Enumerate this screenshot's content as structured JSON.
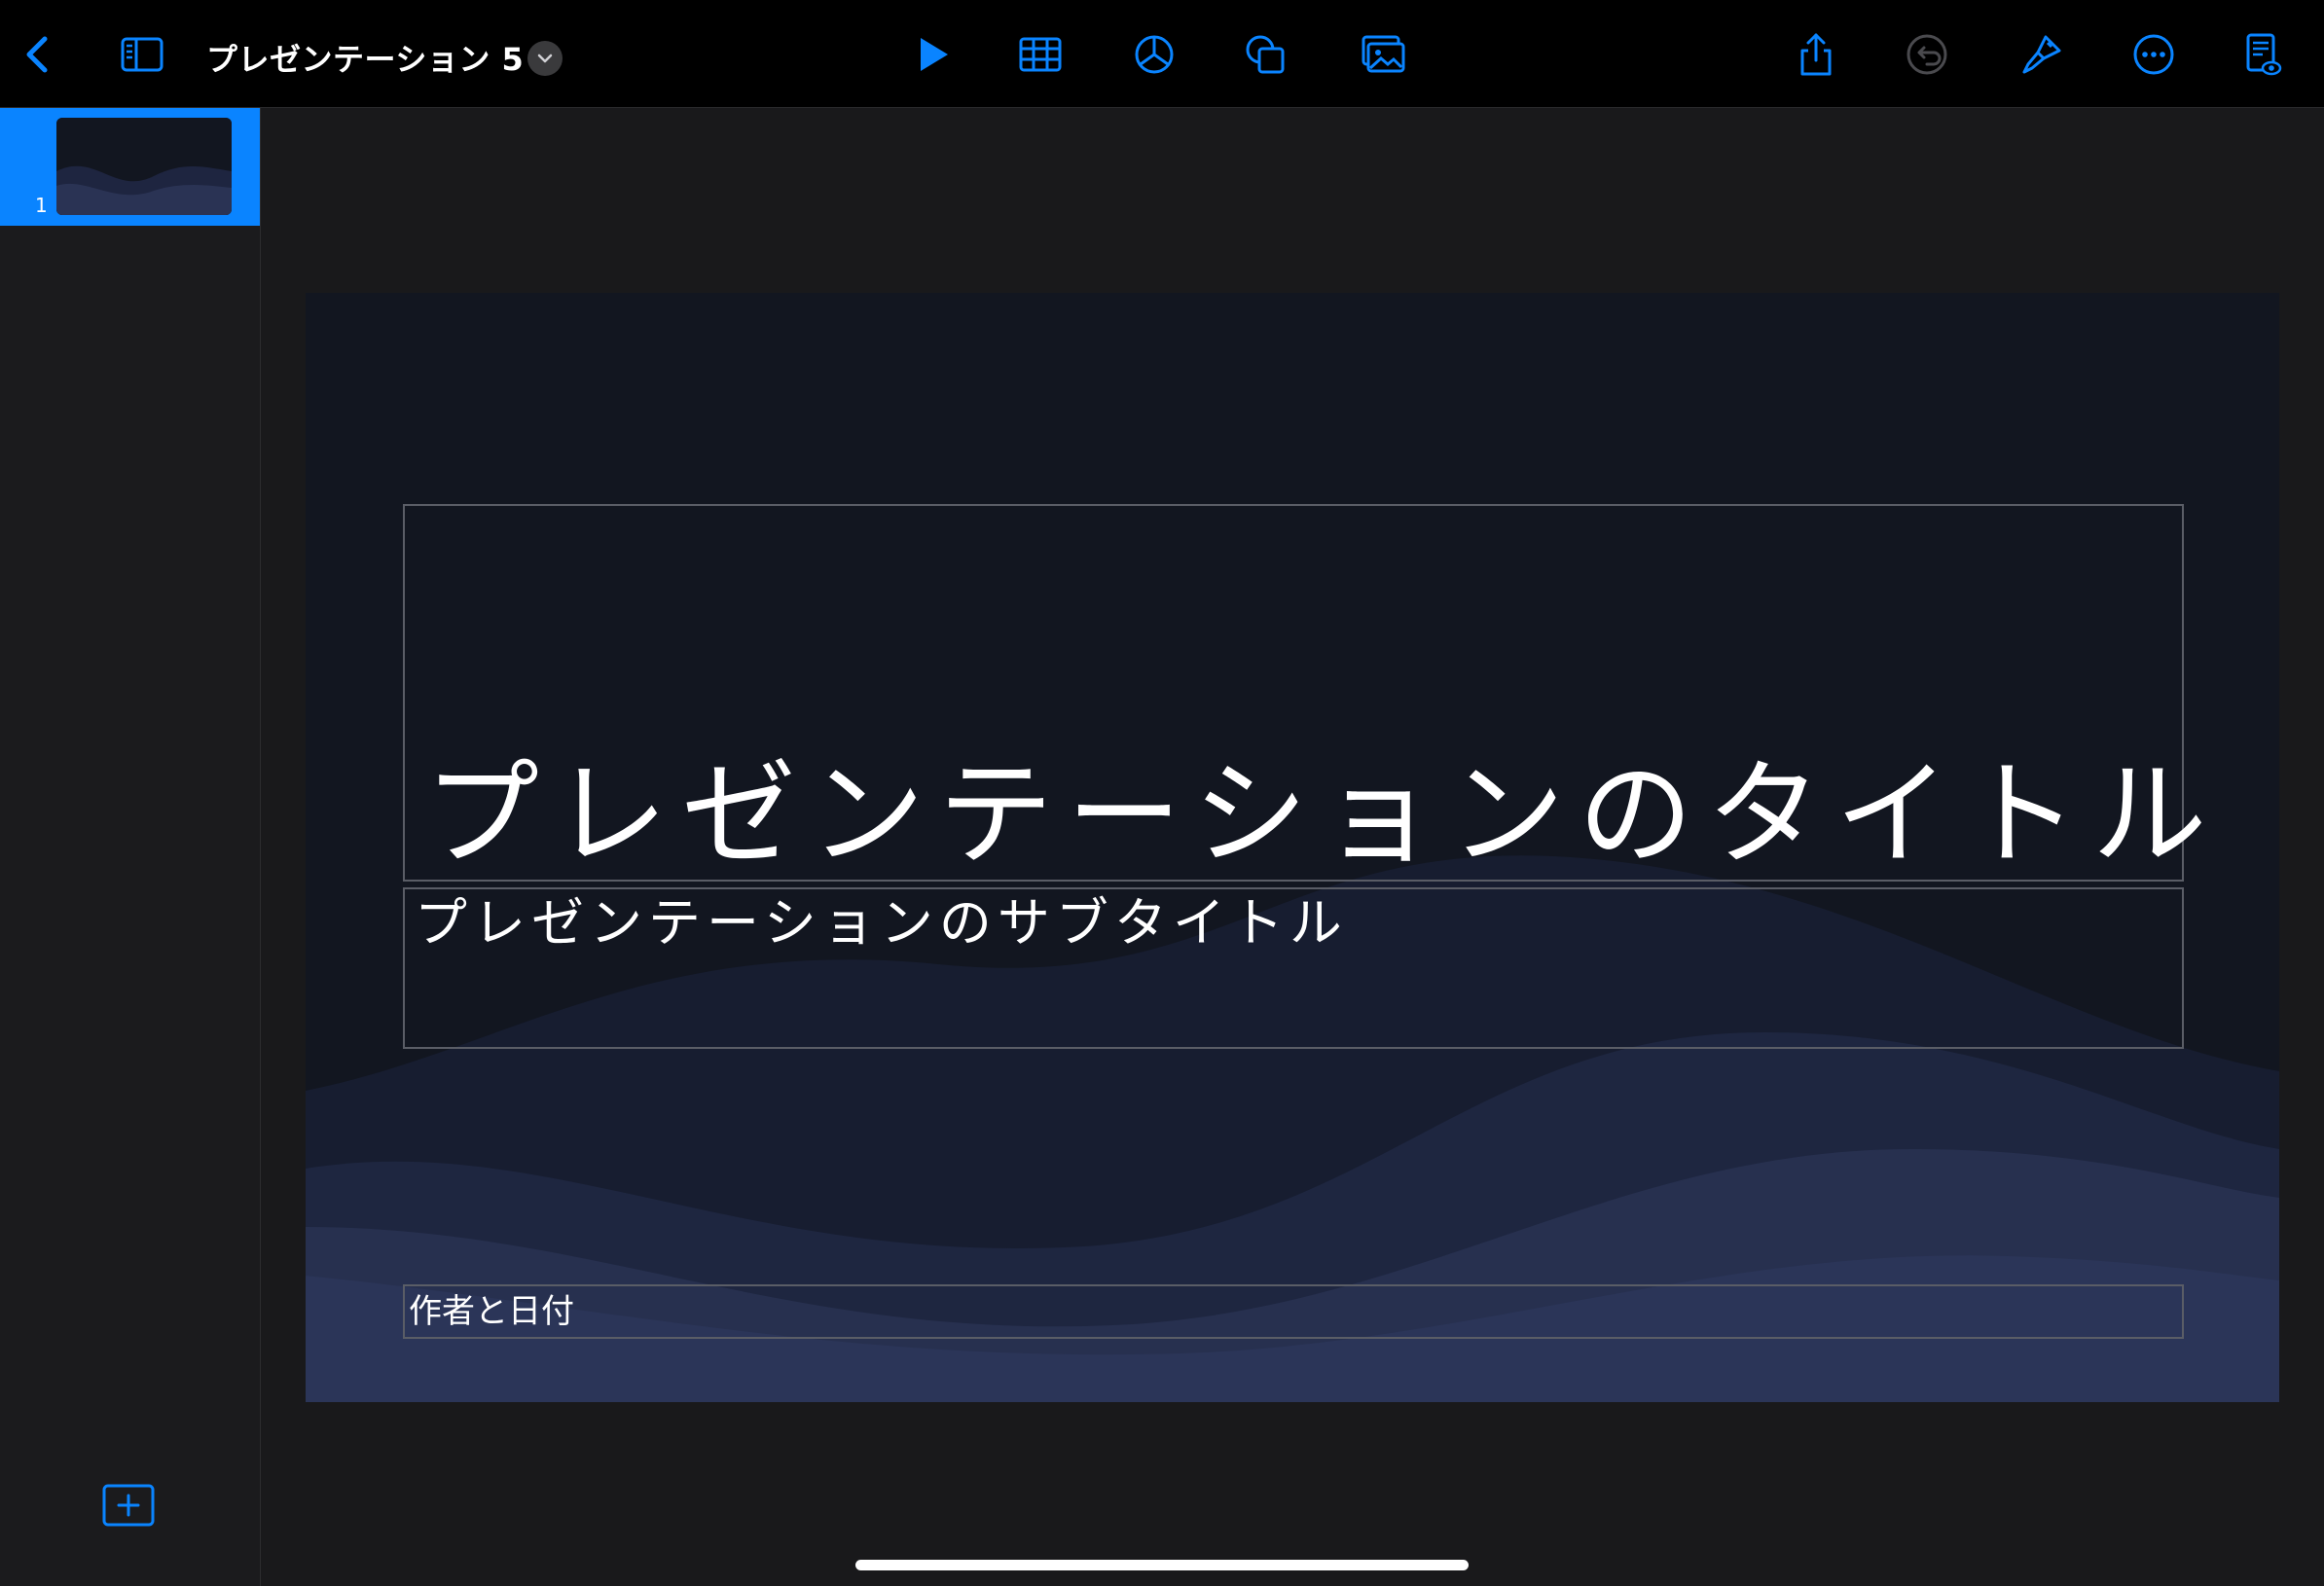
{
  "toolbar": {
    "document_title": "プレゼンテーション 5",
    "icons": [
      "back-chevron-icon",
      "sidebar-toggle-icon",
      "title-chevron-down-icon",
      "play-icon",
      "table-icon",
      "chart-icon",
      "shape-icon",
      "media-icon",
      "share-icon",
      "undo-icon",
      "format-brush-icon",
      "more-icon",
      "reading-view-icon"
    ]
  },
  "sidebar": {
    "slides": [
      {
        "number": "1"
      }
    ],
    "add_slide_icon": "add-slide-icon"
  },
  "slide": {
    "title": "プレゼンテーションのタイトル",
    "subtitle": "プレゼンテーションのサブタイトル",
    "author_date": "作者と日付"
  },
  "colors": {
    "accent": "#0a84ff",
    "toolbar_bg": "#000000",
    "app_bg": "#19191b",
    "slide_bg": "#121620",
    "wave": "#2a3354"
  }
}
